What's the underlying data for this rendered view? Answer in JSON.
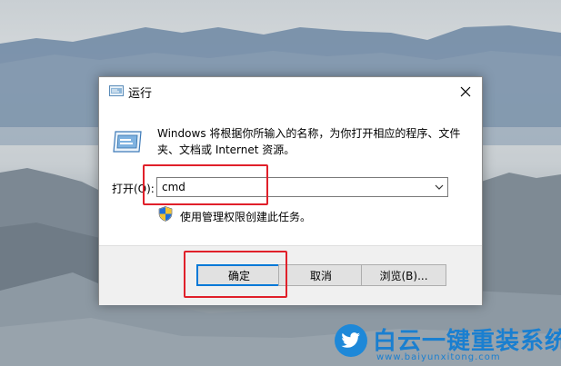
{
  "dialog": {
    "title": "运行",
    "description": "Windows 将根据你所输入的名称，为你打开相应的程序、文件夹、文档或 Internet 资源。",
    "open_label": "打开(O):",
    "input_value": "cmd",
    "admin_note": "使用管理权限创建此任务。",
    "buttons": {
      "ok": "确定",
      "cancel": "取消",
      "browse": "浏览(B)..."
    },
    "accent_color": "#0078d7"
  },
  "annotations": {
    "highlight_color": "#e0202a"
  },
  "watermark": {
    "title": "白云一键重装系统",
    "url": "www.baiyunxitong.com"
  },
  "icons": {
    "title_icon": "run-app-icon",
    "close_icon": "close-icon",
    "run_icon": "run-app-icon",
    "dropdown_icon": "chevron-down-icon",
    "shield_icon": "shield-icon",
    "watermark_icon": "twitter-bird-icon"
  }
}
